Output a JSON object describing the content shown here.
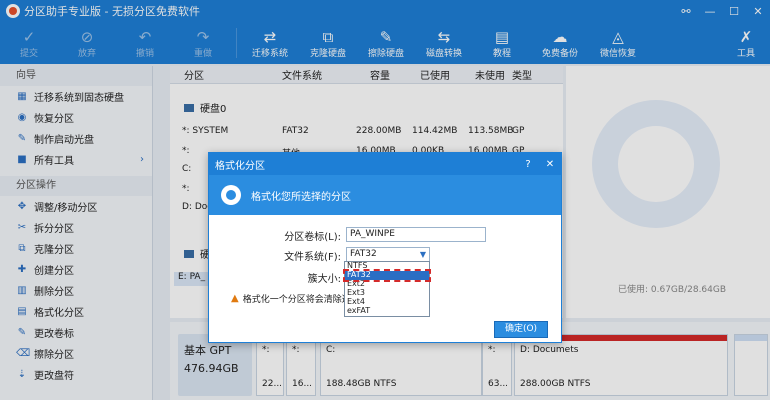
{
  "app": {
    "title": "分区助手专业版 - 无损分区免费软件",
    "window_buttons": [
      "⚯",
      "—",
      "☐",
      "✕"
    ]
  },
  "toolbar": {
    "items": [
      {
        "label": "提交",
        "icon": "✓",
        "enabled": false
      },
      {
        "label": "放弃",
        "icon": "⊘",
        "enabled": false
      },
      {
        "label": "撤销",
        "icon": "↶",
        "enabled": false
      },
      {
        "label": "重做",
        "icon": "↷",
        "enabled": false
      },
      {
        "label": "迁移系统",
        "icon": "⇄",
        "enabled": true
      },
      {
        "label": "克隆硬盘",
        "icon": "⧉",
        "enabled": true
      },
      {
        "label": "擦除硬盘",
        "icon": "✎",
        "enabled": true
      },
      {
        "label": "磁盘转换",
        "icon": "⇆",
        "enabled": true
      },
      {
        "label": "教程",
        "icon": "▤",
        "enabled": true
      },
      {
        "label": "免费备份",
        "icon": "☁",
        "enabled": true
      },
      {
        "label": "微信恢复",
        "icon": "◬",
        "enabled": true
      }
    ],
    "tools_label": "工具",
    "tools_icon": "✗"
  },
  "sidebar": {
    "wizard_header": "向导",
    "wizard_items": [
      {
        "label": "迁移系统到固态硬盘",
        "icon": "▦"
      },
      {
        "label": "恢复分区",
        "icon": "◉"
      },
      {
        "label": "制作启动光盘",
        "icon": "✎"
      },
      {
        "label": "所有工具",
        "icon": "■",
        "arrow": "›"
      }
    ],
    "ops_header": "分区操作",
    "ops_items": [
      {
        "label": "调整/移动分区",
        "icon": "✥"
      },
      {
        "label": "拆分分区",
        "icon": "✂"
      },
      {
        "label": "克隆分区",
        "icon": "⧉"
      },
      {
        "label": "创建分区",
        "icon": "✚"
      },
      {
        "label": "删除分区",
        "icon": "▥"
      },
      {
        "label": "格式化分区",
        "icon": "▤"
      },
      {
        "label": "更改卷标",
        "icon": "✎"
      },
      {
        "label": "擦除分区",
        "icon": "⌫"
      },
      {
        "label": "更改盘符",
        "icon": "⇣"
      }
    ]
  },
  "table": {
    "headers": [
      "分区",
      "文件系统",
      "容量",
      "已使用",
      "未使用",
      "类型"
    ],
    "disk0_label": "硬盘0",
    "rows": [
      {
        "part": "*: SYSTEM",
        "fs": "FAT32",
        "cap": "228.00MB",
        "used": "114.42MB",
        "free": "113.58MB",
        "type": "GP"
      },
      {
        "part": "*:",
        "fs": "其他",
        "cap": "16.00MB",
        "used": "0.00KB",
        "free": "16.00MB",
        "type": "GP"
      },
      {
        "part": "C:",
        "fs": "",
        "cap": "",
        "used": "",
        "free": "",
        "type": ""
      },
      {
        "part": "*:",
        "fs": "",
        "cap": "",
        "used": "",
        "free": "",
        "type": ""
      },
      {
        "part": "D: Docu",
        "fs": "",
        "cap": "",
        "used": "",
        "free": "",
        "type": ""
      }
    ],
    "disk1_label": "硬",
    "disk1_row": "E: PA_"
  },
  "right_panel": {
    "used_text": "已使用: 0.67GB/28.64GB"
  },
  "bottom": {
    "disk_type": "基本 GPT",
    "disk_size": "476.94GB",
    "partitions": [
      {
        "name": "*:",
        "line2": "22...",
        "fs": ""
      },
      {
        "name": "*:",
        "line2": "16...",
        "fs": ""
      },
      {
        "name": "C:",
        "line2": "188.48GB NTFS",
        "fs": ""
      },
      {
        "name": "*:",
        "line2": "63...",
        "fs": ""
      },
      {
        "name": "D: Documets",
        "line2": "288.00GB NTFS",
        "fs": ""
      },
      {
        "name": "",
        "line2": "",
        "fs": ""
      }
    ]
  },
  "dialog": {
    "title": "格式化分区",
    "title_buttons": [
      "?",
      "✕"
    ],
    "heading": "格式化您所选择的分区",
    "volume_label_lbl": "分区卷标(L):",
    "volume_label_val": "PA_WINPE",
    "fs_lbl": "文件系统(F):",
    "fs_val": "FAT32",
    "cluster_lbl": "簇大小:",
    "fs_options": [
      "NTFS",
      "FAT32",
      "Ext2",
      "Ext3",
      "Ext4",
      "exFAT"
    ],
    "selected_option": "FAT32",
    "warning": "格式化一个分区将会清除这",
    "ok_label": "确定(O)"
  }
}
